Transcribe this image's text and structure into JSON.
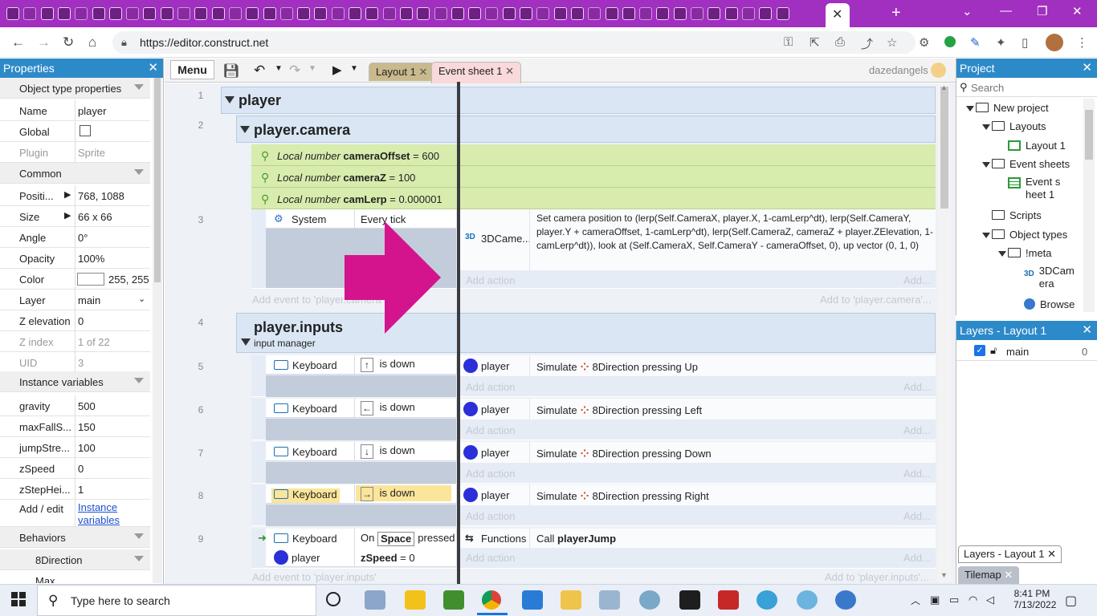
{
  "browser": {
    "url": "https://editor.construct.net",
    "new_tab": "+",
    "close_tab": "✕"
  },
  "props": {
    "title": "Properties",
    "section_object": "Object type properties",
    "rows": [
      {
        "k": "Name",
        "v": "player"
      },
      {
        "k": "Global",
        "v": ""
      },
      {
        "k": "Plugin",
        "v": "Sprite"
      }
    ],
    "section_common": "Common",
    "common": [
      {
        "k": "Positi...",
        "v": "768, 1088"
      },
      {
        "k": "Size",
        "v": "66 x 66"
      },
      {
        "k": "Angle",
        "v": "0°"
      },
      {
        "k": "Opacity",
        "v": "100%"
      },
      {
        "k": "Color",
        "v": "255, 255"
      },
      {
        "k": "Layer",
        "v": "main"
      },
      {
        "k": "Z elevation",
        "v": "0"
      },
      {
        "k": "Z index",
        "v": "1 of 22"
      },
      {
        "k": "UID",
        "v": "3"
      }
    ],
    "section_instvars": "Instance variables",
    "instvars": [
      {
        "k": "gravity",
        "v": "500"
      },
      {
        "k": "maxFallS...",
        "v": "150"
      },
      {
        "k": "jumpStre...",
        "v": "100"
      },
      {
        "k": "zSpeed",
        "v": "0"
      },
      {
        "k": "zStepHei...",
        "v": "1"
      }
    ],
    "add_edit": "Add / edit",
    "instance_link1": "Instance",
    "instance_link2": "variables",
    "section_behaviors": "Behaviors",
    "behavior": "8Direction",
    "max": "Max"
  },
  "editor": {
    "menu": "Menu",
    "tabs": [
      "Layout 1",
      "Event sheet 1"
    ],
    "user": "dazedangels",
    "lines": [
      "1",
      "2",
      "3",
      "4",
      "5",
      "6",
      "7",
      "8",
      "9"
    ],
    "group_player": "player",
    "group_camera": "player.camera",
    "vars": [
      {
        "pre": "Local number",
        "name": "cameraOffset",
        "eq": "= 600"
      },
      {
        "pre": "Local number",
        "name": "cameraZ",
        "eq": "= 100"
      },
      {
        "pre": "Local number",
        "name": "camLerp",
        "eq": "= 0.000001"
      }
    ],
    "ev3": {
      "cond_obj": "System",
      "cond_text": "Every tick",
      "act_obj": "3DCame...",
      "act_text": "Set camera position to (lerp(Self.CameraX, player.X, 1-camLerp^dt), lerp(Self.CameraY, player.Y + cameraOffset, 1-camLerp^dt), lerp(Self.CameraZ, cameraZ + player.ZElevation, 1-camLerp^dt)), look at (Self.CameraX, Self.CameraY - cameraOffset, 0), up vector (0, 1, 0)"
    },
    "add_action": "Add action",
    "add_dots": "Add...",
    "add_event_camera": "Add event to 'player.camera'",
    "add_to_camera": "Add to 'player.camera'...",
    "group_inputs": "player.inputs",
    "inputs_desc": "input manager",
    "key_events": [
      {
        "key": "↑",
        "dir": "Up"
      },
      {
        "key": "←",
        "dir": "Left"
      },
      {
        "key": "↓",
        "dir": "Down"
      },
      {
        "key": "→",
        "dir": "Right"
      }
    ],
    "keyboard": "Keyboard",
    "is_down": "is down",
    "player": "player",
    "simulate": "Simulate",
    "direction8": "8Direction pressing",
    "ev9": {
      "on": "On",
      "space": "Space",
      "pressed": "pressed",
      "functions": "Functions",
      "call": "Call",
      "fn": "playerJump",
      "zspeed": "zSpeed",
      "zeq": "= 0"
    },
    "add_event_inputs": "Add event to 'player.inputs'",
    "add_to_inputs": "Add to 'player.inputs'..."
  },
  "project": {
    "title": "Project",
    "search": "Search",
    "tree": [
      "New project",
      "Layouts",
      "Layout 1",
      "Event sheets",
      "Event sheet 1",
      "Scripts",
      "Object types",
      "!meta",
      "3DCamera",
      "Browse"
    ]
  },
  "layers": {
    "title": "Layers - Layout 1",
    "main": "main",
    "count": "0",
    "tab1": "Layers - Layout 1",
    "tab2": "Tilemap"
  },
  "taskbar": {
    "search": "Type here to search",
    "time": "8:41 PM",
    "date": "7/13/2022"
  }
}
